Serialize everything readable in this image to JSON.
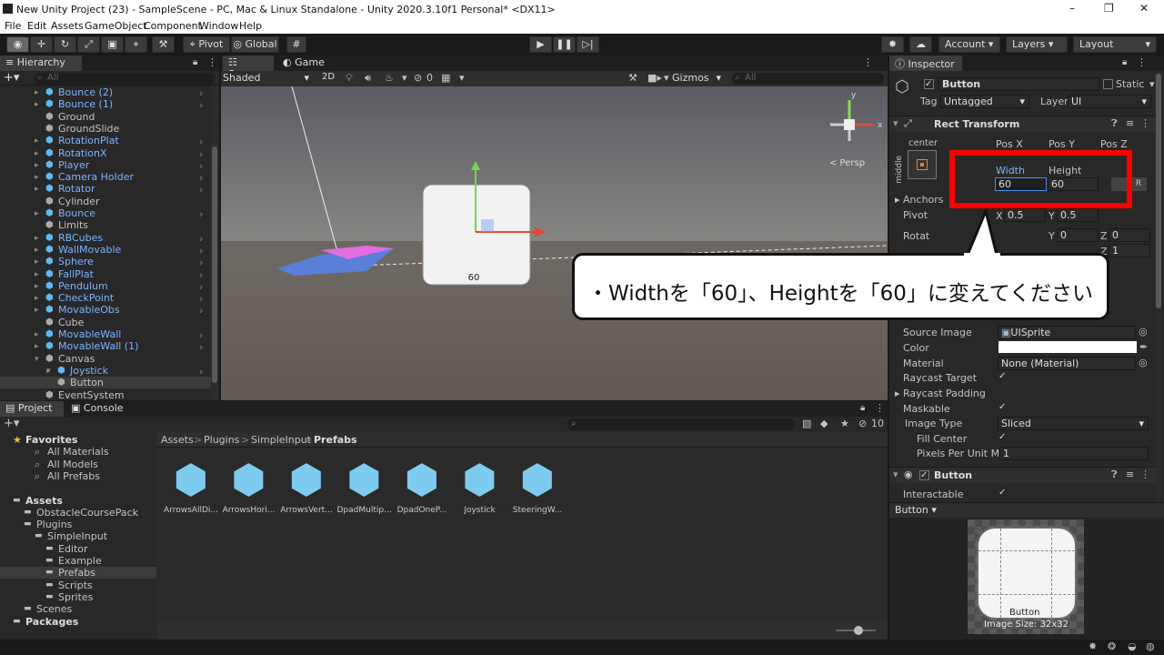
{
  "window": {
    "title": "New Unity Project (23) - SampleScene - PC, Mac & Linux Standalone - Unity 2020.3.10f1 Personal* <DX11>"
  },
  "menu": [
    "File",
    "Edit",
    "Assets",
    "GameObject",
    "Component",
    "Window",
    "Help"
  ],
  "toolbar": {
    "pivot": "Pivot",
    "global": "Global",
    "account": "Account",
    "layers": "Layers",
    "layout": "Layout"
  },
  "hierarchy": {
    "tab": "Hierarchy",
    "search_placeholder": "All",
    "items": [
      {
        "label": "Bounce (2)",
        "blue": true,
        "indent": 0
      },
      {
        "label": "Bounce (1)",
        "blue": true,
        "indent": 0
      },
      {
        "label": "Ground",
        "blue": false,
        "indent": 0
      },
      {
        "label": "GroundSlide",
        "blue": false,
        "indent": 0
      },
      {
        "label": "RotationPlat",
        "blue": true,
        "indent": 0
      },
      {
        "label": "RotationX",
        "blue": true,
        "indent": 0
      },
      {
        "label": "Player",
        "blue": true,
        "indent": 0
      },
      {
        "label": "Camera Holder",
        "blue": true,
        "indent": 0
      },
      {
        "label": "Rotator",
        "blue": true,
        "indent": 0
      },
      {
        "label": "Cylinder",
        "blue": false,
        "indent": 0
      },
      {
        "label": "Bounce",
        "blue": true,
        "indent": 0
      },
      {
        "label": "Limits",
        "blue": false,
        "indent": 0
      },
      {
        "label": "RBCubes",
        "blue": true,
        "indent": 0
      },
      {
        "label": "WallMovable",
        "blue": true,
        "indent": 0
      },
      {
        "label": "Sphere",
        "blue": true,
        "indent": 0
      },
      {
        "label": "FallPlat",
        "blue": true,
        "indent": 0
      },
      {
        "label": "Pendulum",
        "blue": true,
        "indent": 0
      },
      {
        "label": "CheckPoint",
        "blue": true,
        "indent": 0
      },
      {
        "label": "MovableObs",
        "blue": true,
        "indent": 0
      },
      {
        "label": "Cube",
        "blue": false,
        "indent": 0
      },
      {
        "label": "MovableWall",
        "blue": true,
        "indent": 0
      },
      {
        "label": "MovableWall (1)",
        "blue": true,
        "indent": 0
      },
      {
        "label": "Canvas",
        "blue": false,
        "indent": 0
      },
      {
        "label": "Joystick",
        "blue": true,
        "indent": 1
      },
      {
        "label": "Button",
        "blue": false,
        "indent": 1
      },
      {
        "label": "EventSystem",
        "blue": false,
        "indent": 0
      }
    ]
  },
  "scene": {
    "tabs": [
      "Scene",
      "Game"
    ],
    "shading": "Shaded",
    "mode2d": "2D",
    "gizmo_count": "0",
    "gizmos": "Gizmos",
    "search_placeholder": "All",
    "persp": "< Persp",
    "object_label": "60",
    "axis_y": "y",
    "axis_x": "x"
  },
  "inspector": {
    "tab": "Inspector",
    "object_name": "Button",
    "static": "Static",
    "tag_label": "Tag",
    "tag_value": "Untagged",
    "layer_label": "Layer",
    "layer_value": "UI",
    "rect_transform": "Rect Transform",
    "anchor_h": "center",
    "anchor_v": "middle",
    "posx": "Pos X",
    "posy": "Pos Y",
    "posz": "Pos Z",
    "width_label": "Width",
    "height_label": "Height",
    "width_value": "60",
    "height_value": "60",
    "anchors": "Anchors",
    "pivot_label": "Pivot",
    "pivot_x": "0.5",
    "pivot_y": "0.5",
    "rotation_label": "Rotat",
    "rot_y": "0",
    "rot_z": "0",
    "scale_z": "1",
    "x_label": "X",
    "y_label": "Y",
    "z_label": "Z",
    "source_image_label": "Source Image",
    "source_image": "UISprite",
    "color_label": "Color",
    "material_label": "Material",
    "material": "None (Material)",
    "raycast_target": "Raycast Target",
    "raycast_padding": "Raycast Padding",
    "maskable": "Maskable",
    "image_type_label": "Image Type",
    "image_type": "Sliced",
    "fill_center": "Fill Center",
    "ppu_label": "Pixels Per Unit Mul",
    "ppu_value": "1",
    "button_section": "Button",
    "interactable": "Interactable",
    "preview_dropdown": "Button",
    "preview_name": "Button",
    "preview_size": "Image Size: 32x32"
  },
  "callout": "・Widthを「60」、Heightを「60」に変えてください",
  "project": {
    "tabs": [
      "Project",
      "Console"
    ],
    "breadcrumb": [
      "Assets",
      "Plugins",
      "SimpleInput",
      "Prefabs"
    ],
    "count": "10",
    "tree": [
      {
        "label": "Favorites",
        "bold": true,
        "indent": 0
      },
      {
        "label": "All Materials",
        "bold": false,
        "indent": 2
      },
      {
        "label": "All Models",
        "bold": false,
        "indent": 2
      },
      {
        "label": "All Prefabs",
        "bold": false,
        "indent": 2
      },
      {
        "label": "",
        "bold": false,
        "indent": 0
      },
      {
        "label": "Assets",
        "bold": true,
        "indent": 0
      },
      {
        "label": "ObstacleCoursePack",
        "bold": false,
        "indent": 1
      },
      {
        "label": "Plugins",
        "bold": false,
        "indent": 1
      },
      {
        "label": "SimpleInput",
        "bold": false,
        "indent": 2
      },
      {
        "label": "Editor",
        "bold": false,
        "indent": 3
      },
      {
        "label": "Example",
        "bold": false,
        "indent": 3
      },
      {
        "label": "Prefabs",
        "bold": false,
        "indent": 3
      },
      {
        "label": "Scripts",
        "bold": false,
        "indent": 3
      },
      {
        "label": "Sprites",
        "bold": false,
        "indent": 3
      },
      {
        "label": "Scenes",
        "bold": false,
        "indent": 1
      },
      {
        "label": "Packages",
        "bold": true,
        "indent": 0
      }
    ],
    "assets": [
      "ArrowsAllDi...",
      "ArrowsHori...",
      "ArrowsVert...",
      "DpadMultip...",
      "DpadOneP...",
      "Joystick",
      "SteeringW..."
    ]
  },
  "colors": {
    "accent": "#7bb3ff",
    "highlight_box": "#ff0000",
    "prefab_icon": "#7ecbf0"
  }
}
